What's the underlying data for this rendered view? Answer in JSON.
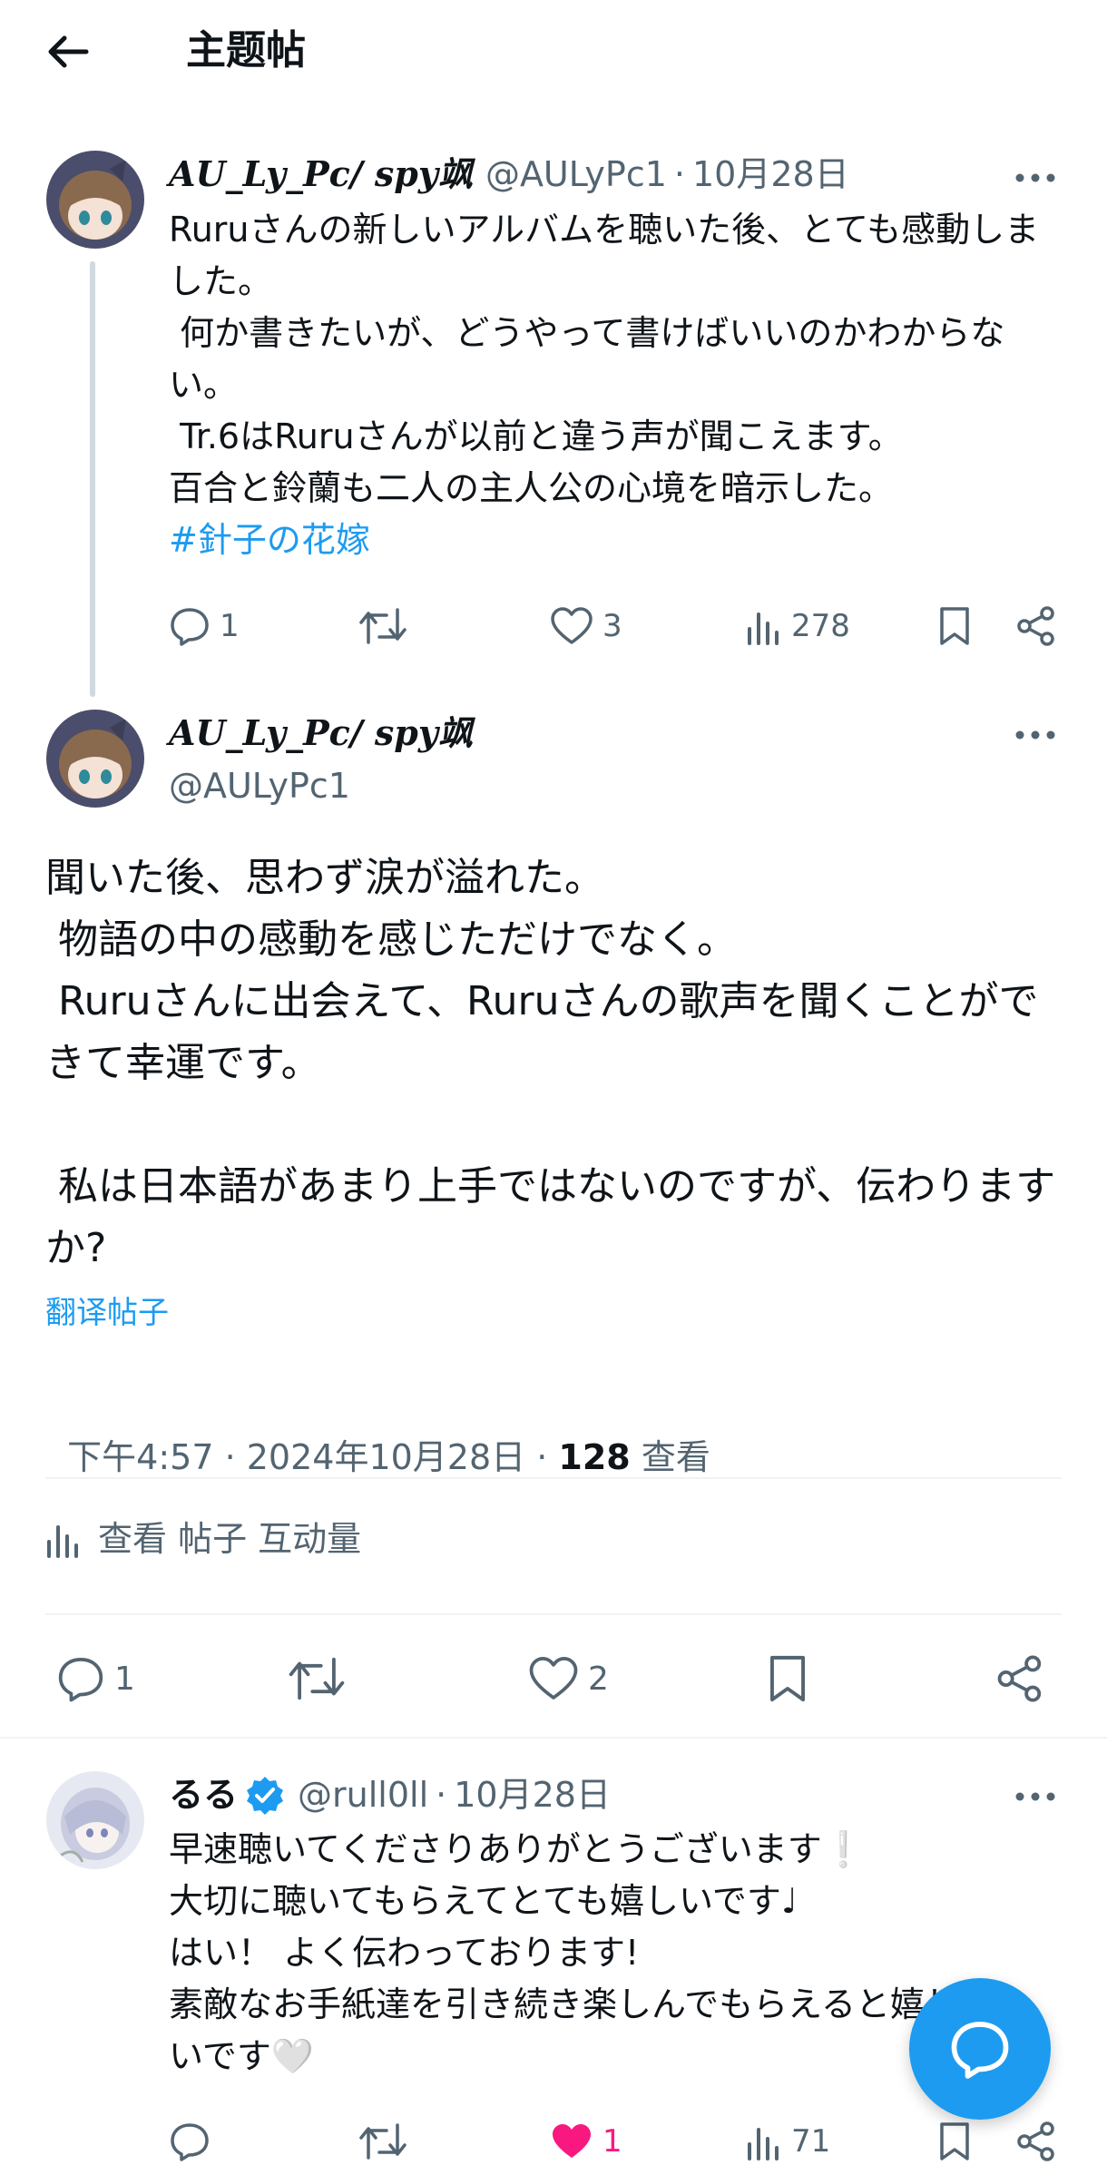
{
  "header": {
    "title": "主题帖"
  },
  "tweet1": {
    "display_name": "AU_Ly_Pc/ spy飒",
    "handle": "@AULyPc1",
    "date": "10月28日",
    "text": "Ruruさんの新しいアルバムを聴いた後、とても感動しました。\n 何か書きたいが、どうやって書けばいいのかわからない。\n Tr.6はRuruさんが以前と違う声が聞こえます。\n百合と鈴蘭も二人の主人公の心境を暗示した。",
    "hashtag": "#針子の花嫁",
    "replies": "1",
    "likes": "3",
    "views": "278"
  },
  "main_tweet": {
    "display_name": "AU_Ly_Pc/ spy飒",
    "handle": "@AULyPc1",
    "text": "聞いた後、思わず涙が溢れた。\n 物語の中の感動を感じただけでなく。\n Ruruさんに出会えて、Ruruさんの歌声を聞くことができて幸運です。\n\n 私は日本語があまり上手ではないのですが、伝わりますか?",
    "translate_label": "翻译帖子",
    "timestamp": "下午4:57 · 2024年10月28日 · ",
    "view_count": "128",
    "view_label": " 查看",
    "engagement_label": "查看 帖子 互动量",
    "replies": "1",
    "likes": "2"
  },
  "reply": {
    "display_name": "るる",
    "handle": "@rull0ll",
    "date": "10月28日",
    "text": "早速聴いてくださりありがとうございます❕\n大切に聴いてもらえてとても嬉しいです♩\nはい！ よく伝わっております!\n素敵なお手紙達を引き続き楽しんでもらえると嬉しいです🤍",
    "likes": "1",
    "views": "71",
    "verified": true
  },
  "colors": {
    "accent": "#1d9bf0",
    "muted": "#536471",
    "like_active": "#f91880",
    "divider": "#eff3f4"
  },
  "icons": [
    "back-arrow-icon",
    "more-icon",
    "reply-icon",
    "repost-icon",
    "like-icon",
    "views-icon",
    "bookmark-icon",
    "share-icon",
    "verified-icon",
    "compose-fab-icon"
  ]
}
